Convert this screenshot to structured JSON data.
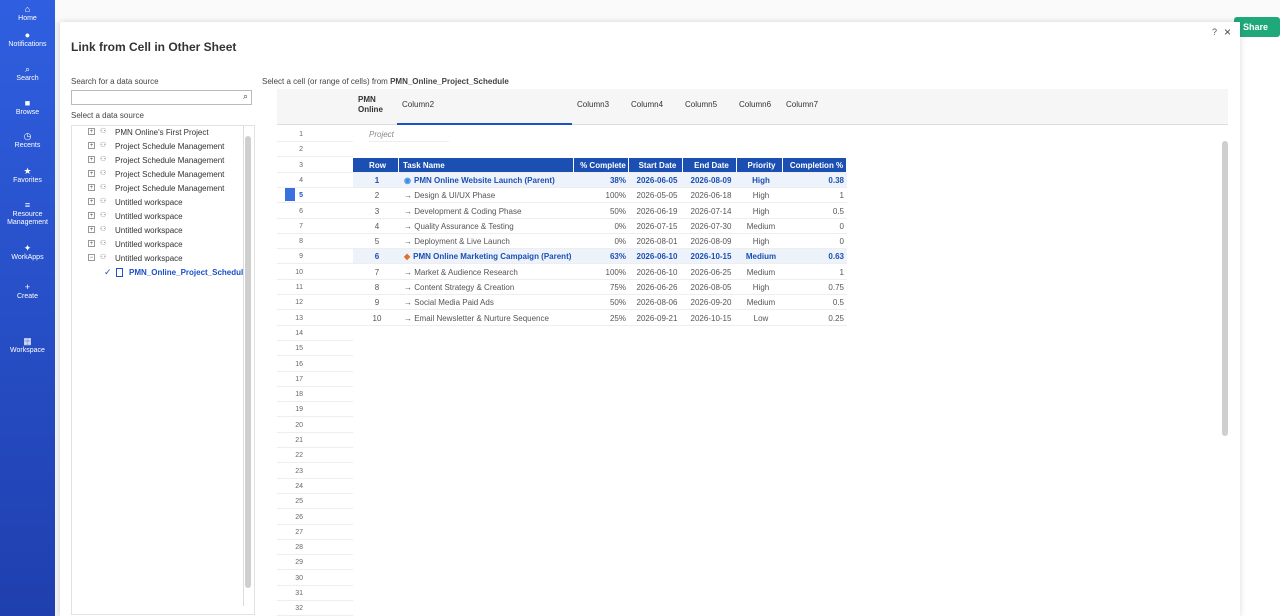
{
  "nav": {
    "items": [
      "Home",
      "Notifications",
      "Search",
      "Browse",
      "Recents",
      "Favorites",
      "Resource Management",
      "WorkApps",
      "Create",
      "Workspace"
    ]
  },
  "header": {
    "share_label": "Share"
  },
  "dialog": {
    "title": "Link from Cell in Other Sheet",
    "help": "?",
    "close": "×",
    "search_label": "Search for a data source",
    "search_placeholder": "",
    "select_label": "Select a data source",
    "instruction_prefix": "Select a cell (or range of cells) from",
    "sheet_name": "PMN_Online_Project_Schedule"
  },
  "tree": [
    {
      "label": "PMN Online's First Project",
      "expander": "+"
    },
    {
      "label": "Project Schedule Management",
      "expander": "+"
    },
    {
      "label": "Project Schedule Management",
      "expander": "+"
    },
    {
      "label": "Project Schedule Management",
      "expander": "+"
    },
    {
      "label": "Project Schedule Management",
      "expander": "+"
    },
    {
      "label": "Untitled workspace",
      "expander": "+"
    },
    {
      "label": "Untitled workspace",
      "expander": "+"
    },
    {
      "label": "Untitled workspace",
      "expander": "+"
    },
    {
      "label": "Untitled workspace",
      "expander": "+"
    },
    {
      "label": "Untitled workspace",
      "expander": "−"
    },
    {
      "label": "PMN_Online_Project_Schedul",
      "selected": true
    }
  ],
  "columns": [
    "PMN Online",
    "Column2",
    "Column3",
    "Column4",
    "Column5",
    "Column6",
    "Column7"
  ],
  "row1_label": "Project",
  "table_header": [
    "Row",
    "Task Name",
    "% Complete",
    "Start Date",
    "End Date",
    "Priority",
    "Completion %"
  ],
  "rows": [
    {
      "row": "1",
      "task": "PMN Online Website Launch (Parent)",
      "pct": "38%",
      "start": "2026-06-05",
      "end": "2026-08-09",
      "priority": "High",
      "comp": "0.38",
      "parent": true,
      "icon": "globe-icon"
    },
    {
      "row": "2",
      "task": "→ Design & UI/UX Phase",
      "pct": "100%",
      "start": "2026-05-05",
      "end": "2026-06-18",
      "priority": "High",
      "comp": "1"
    },
    {
      "row": "3",
      "task": "→ Development & Coding Phase",
      "pct": "50%",
      "start": "2026-06-19",
      "end": "2026-07-14",
      "priority": "High",
      "comp": "0.5"
    },
    {
      "row": "4",
      "task": "→ Quality Assurance & Testing",
      "pct": "0%",
      "start": "2026-07-15",
      "end": "2026-07-30",
      "priority": "Medium",
      "comp": "0"
    },
    {
      "row": "5",
      "task": "→ Deployment & Live Launch",
      "pct": "0%",
      "start": "2026-08-01",
      "end": "2026-08-09",
      "priority": "High",
      "comp": "0"
    },
    {
      "row": "6",
      "task": "PMN Online Marketing Campaign (Parent)",
      "pct": "63%",
      "start": "2026-06-10",
      "end": "2026-10-15",
      "priority": "Medium",
      "comp": "0.63",
      "parent": true,
      "icon": "megaphone-icon"
    },
    {
      "row": "7",
      "task": "→ Market & Audience Research",
      "pct": "100%",
      "start": "2026-06-10",
      "end": "2026-06-25",
      "priority": "Medium",
      "comp": "1"
    },
    {
      "row": "8",
      "task": "→ Content Strategy & Creation",
      "pct": "75%",
      "start": "2026-06-26",
      "end": "2026-08-05",
      "priority": "High",
      "comp": "0.75"
    },
    {
      "row": "9",
      "task": "→ Social Media Paid Ads",
      "pct": "50%",
      "start": "2026-08-06",
      "end": "2026-09-20",
      "priority": "Medium",
      "comp": "0.5"
    },
    {
      "row": "10",
      "task": "→ Email Newsletter & Nurture Sequence",
      "pct": "25%",
      "start": "2026-09-21",
      "end": "2026-10-15",
      "priority": "Low",
      "comp": "0.25"
    }
  ],
  "row_numbers": [
    "1",
    "2",
    "3",
    "4",
    "5",
    "6",
    "7",
    "8",
    "9",
    "10",
    "11",
    "12",
    "13",
    "14",
    "15",
    "16",
    "17",
    "18",
    "19",
    "20",
    "21",
    "22",
    "23",
    "24",
    "25",
    "26",
    "27",
    "28",
    "29",
    "30",
    "31",
    "32"
  ],
  "selected_row": "5"
}
